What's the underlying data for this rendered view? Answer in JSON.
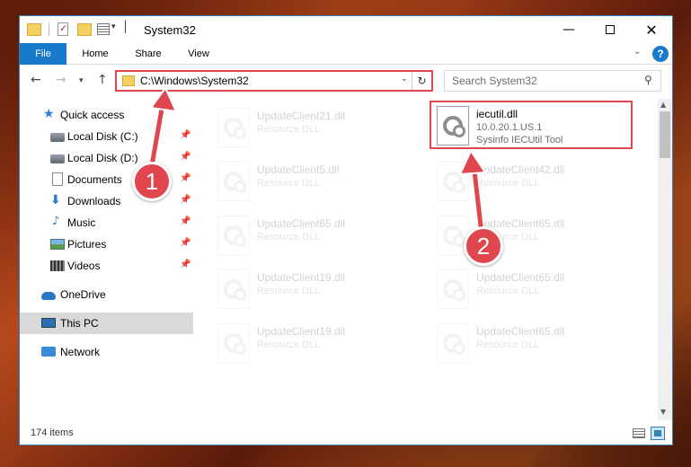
{
  "window": {
    "title": "System32",
    "controls": {
      "minimize": "—",
      "maximize": "",
      "close": "✕"
    }
  },
  "ribbon": {
    "tabs": [
      "File",
      "Home",
      "Share",
      "View"
    ],
    "expand_icon": "chevron-down-icon",
    "help_label": "?"
  },
  "nav": {
    "address": "C:\\Windows\\System32",
    "search_placeholder": "Search System32"
  },
  "sidebar": {
    "items": [
      {
        "label": "Quick access",
        "icon": "star-icon"
      },
      {
        "label": "Local Disk (C:)",
        "icon": "disk-icon",
        "pinned": true
      },
      {
        "label": "Local Disk (D:)",
        "icon": "disk-icon",
        "pinned": true
      },
      {
        "label": "Documents",
        "icon": "documents-icon",
        "pinned": true
      },
      {
        "label": "Downloads",
        "icon": "download-icon",
        "pinned": true
      },
      {
        "label": "Music",
        "icon": "music-icon",
        "pinned": true
      },
      {
        "label": "Pictures",
        "icon": "pictures-icon",
        "pinned": true
      },
      {
        "label": "Videos",
        "icon": "videos-icon",
        "pinned": true
      },
      {
        "label": "OneDrive",
        "icon": "cloud-icon"
      },
      {
        "label": "This PC",
        "icon": "computer-icon",
        "selected": true
      },
      {
        "label": "Network",
        "icon": "network-icon"
      }
    ]
  },
  "files": [
    {
      "name": "UpdateClient21.dll",
      "type": "Resource DLL"
    },
    {
      "name": "iecutil.dll",
      "type": "10.0.20.1.US.1",
      "company": "Sysinfo IECUtil Tool",
      "highlighted": true
    },
    {
      "name": "UpdateClient5.dll",
      "type": "Resource DLL"
    },
    {
      "name": "UpdateClient42.dll",
      "type": "Resource DLL"
    },
    {
      "name": "UpdateClient65.dll",
      "type": "Resource DLL"
    },
    {
      "name": "UpdateClient65.dll",
      "type": "Resource DLL"
    },
    {
      "name": "UpdateClient19.dll",
      "type": "Resource DLL"
    },
    {
      "name": "UpdateClient65.dll",
      "type": "Resource DLL"
    },
    {
      "name": "UpdateClient19.dll",
      "type": "Resource DLL"
    },
    {
      "name": "UpdateClient65.dll",
      "type": "Resource DLL"
    }
  ],
  "status": {
    "item_count": "174 items"
  },
  "annotations": {
    "step1": "1",
    "step2": "2",
    "accent": "#e0464e"
  }
}
